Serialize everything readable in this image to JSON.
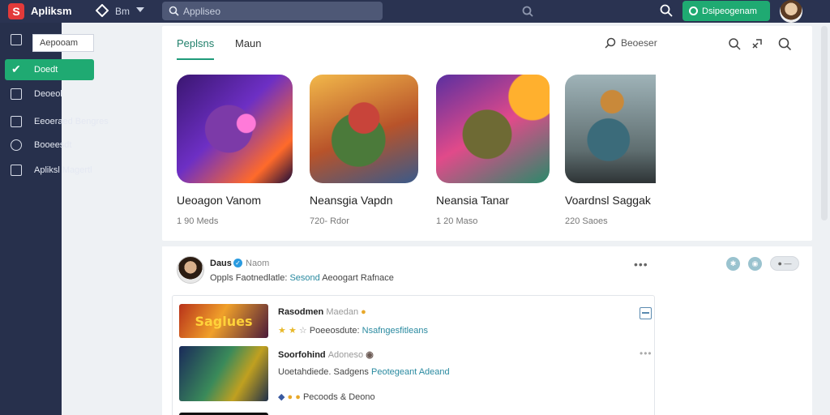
{
  "topbar": {
    "logo_letter": "S",
    "app_name": "Apliksm",
    "nav_label": "Bm",
    "search_placeholder": "Appliseo",
    "cta_label": "Dsipeogenam"
  },
  "sidebar": {
    "items": [
      {
        "label": "Aepooam",
        "icon": "document-icon"
      },
      {
        "label": "Doedt",
        "icon": "check-icon"
      },
      {
        "label": "Deoeol",
        "icon": "square-icon"
      },
      {
        "label": "Eeoeraed Bengres",
        "icon": "list-icon"
      },
      {
        "label": "Booeesdt",
        "icon": "circle-icon"
      },
      {
        "label": "Apliksl Magertl",
        "icon": "panel-icon"
      }
    ]
  },
  "main": {
    "tabs": [
      "Peplsns",
      "Maun"
    ],
    "search_label": "Beoeser",
    "apps": [
      {
        "name": "Ueoagon Vanom",
        "meta": "1 90 Meds"
      },
      {
        "name": "Neansgia Vapdn",
        "meta": "720- Rdor"
      },
      {
        "name": "Neansia Tanar",
        "meta": "1 20 Maso"
      },
      {
        "name": "Voardnsl Saggak",
        "meta": "220 Saoes"
      }
    ]
  },
  "feed": {
    "post": {
      "author": "Daus",
      "handle": "Naom",
      "text_prefix": "Oppls Faotnedlatle:",
      "text_link": "Sesond",
      "text_suffix": "Aeoogart Rafnace"
    },
    "rows": [
      {
        "title": "Rasodmen",
        "title_muted": "Maedan",
        "thumb_text": "Saglues",
        "sub_prefix": "",
        "sub_meta": "Poeeosdute:",
        "sub_link": "Nsafngesfitleans"
      },
      {
        "title": "Soorfohind",
        "title_muted": "Adoneso",
        "thumb_text": "",
        "sub_prefix": "Uoetahdiede. Sadgens",
        "sub_link": "Peotegeant Adeand",
        "meta": "Pecoods & Deono"
      }
    ],
    "pill_label": "● —"
  },
  "colors": {
    "topbar_bg": "#2a3351",
    "sidebar_bg": "#27304c",
    "accent_green": "#1faa72",
    "link_teal": "#2a8aa0"
  }
}
